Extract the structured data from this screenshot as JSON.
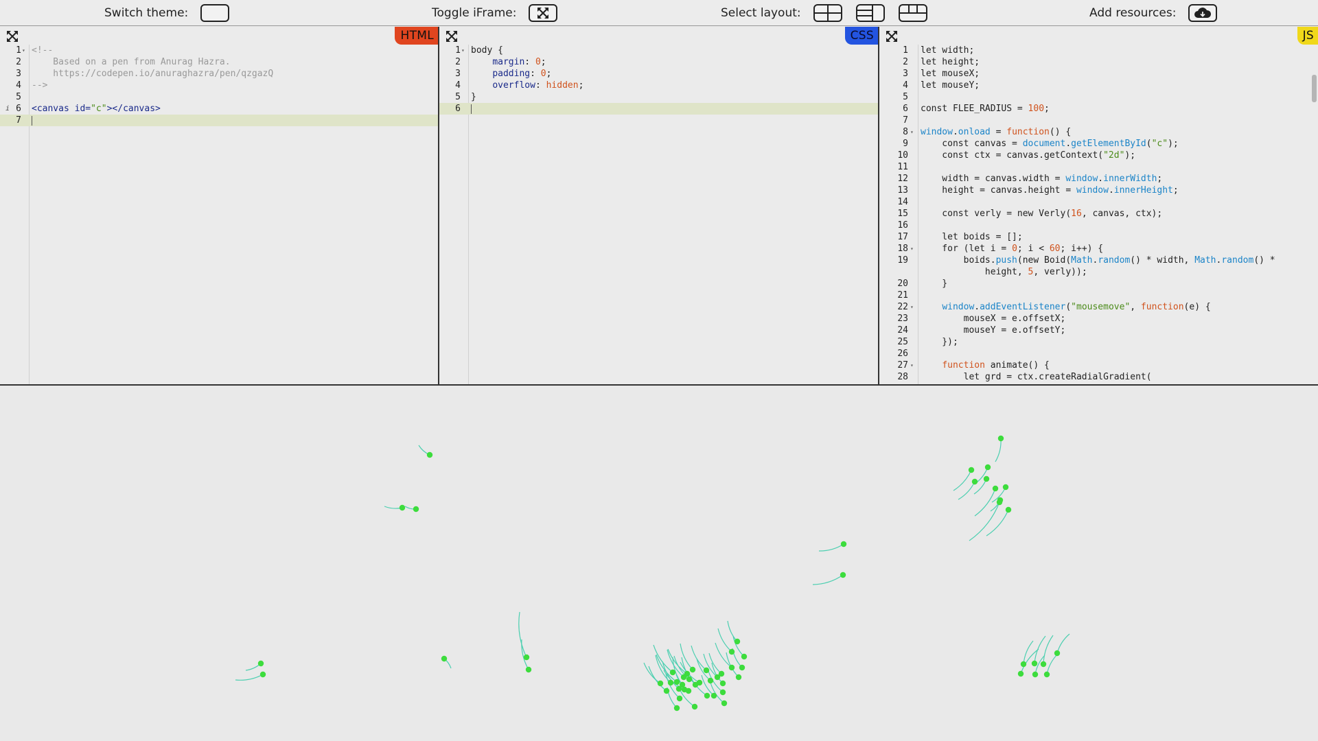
{
  "toolbar": {
    "switch_theme_label": "Switch theme:",
    "toggle_iframe_label": "Toggle iFrame:",
    "select_layout_label": "Select layout:",
    "add_resources_label": "Add resources:",
    "icons": [
      "moon-icon",
      "expand-icon",
      "layout-grid-icon",
      "layout-sidebar-icon",
      "layout-columns-icon",
      "cloud-download-icon"
    ]
  },
  "panes": {
    "html": {
      "badge": "HTML",
      "badge_color": "#e0451f"
    },
    "css": {
      "badge": "CSS",
      "badge_color": "#2354e0"
    },
    "js": {
      "badge": "JS",
      "badge_color": "#f0d81a"
    }
  },
  "html_code": [
    "<!--",
    "    Based on a pen from Anurag Hazra.",
    "    https://codepen.io/anuraghazra/pen/qzgazQ",
    "-->",
    "",
    "<canvas id=\"c\"></canvas>",
    ""
  ],
  "css_code": [
    "body {",
    "    margin: 0;",
    "    padding: 0;",
    "    overflow: hidden;",
    "}",
    ""
  ],
  "js_code": [
    "let width;",
    "let height;",
    "let mouseX;",
    "let mouseY;",
    "",
    "const FLEE_RADIUS = 100;",
    "",
    "window.onload = function() {",
    "    const canvas = document.getElementById(\"c\");",
    "    const ctx = canvas.getContext(\"2d\");",
    "",
    "    width = canvas.width = window.innerWidth;",
    "    height = canvas.height = window.innerHeight;",
    "",
    "    const verly = new Verly(16, canvas, ctx);",
    "",
    "    let boids = [];",
    "    for (let i = 0; i < 60; i++) {",
    "        boids.push(new Boid(Math.random() * width, Math.random() *",
    "            height, 5, verly));",
    "    }",
    "",
    "    window.addEventListener(\"mousemove\", function(e) {",
    "        mouseX = e.offsetX;",
    "        mouseY = e.offsetY;",
    "    });",
    "",
    "    function animate() {",
    "        let grd = ctx.createRadialGradient("
  ],
  "colors": {
    "boid": "#3ddc3d",
    "tail": "#4ccfb0",
    "active_line": "#dfe4c8"
  }
}
